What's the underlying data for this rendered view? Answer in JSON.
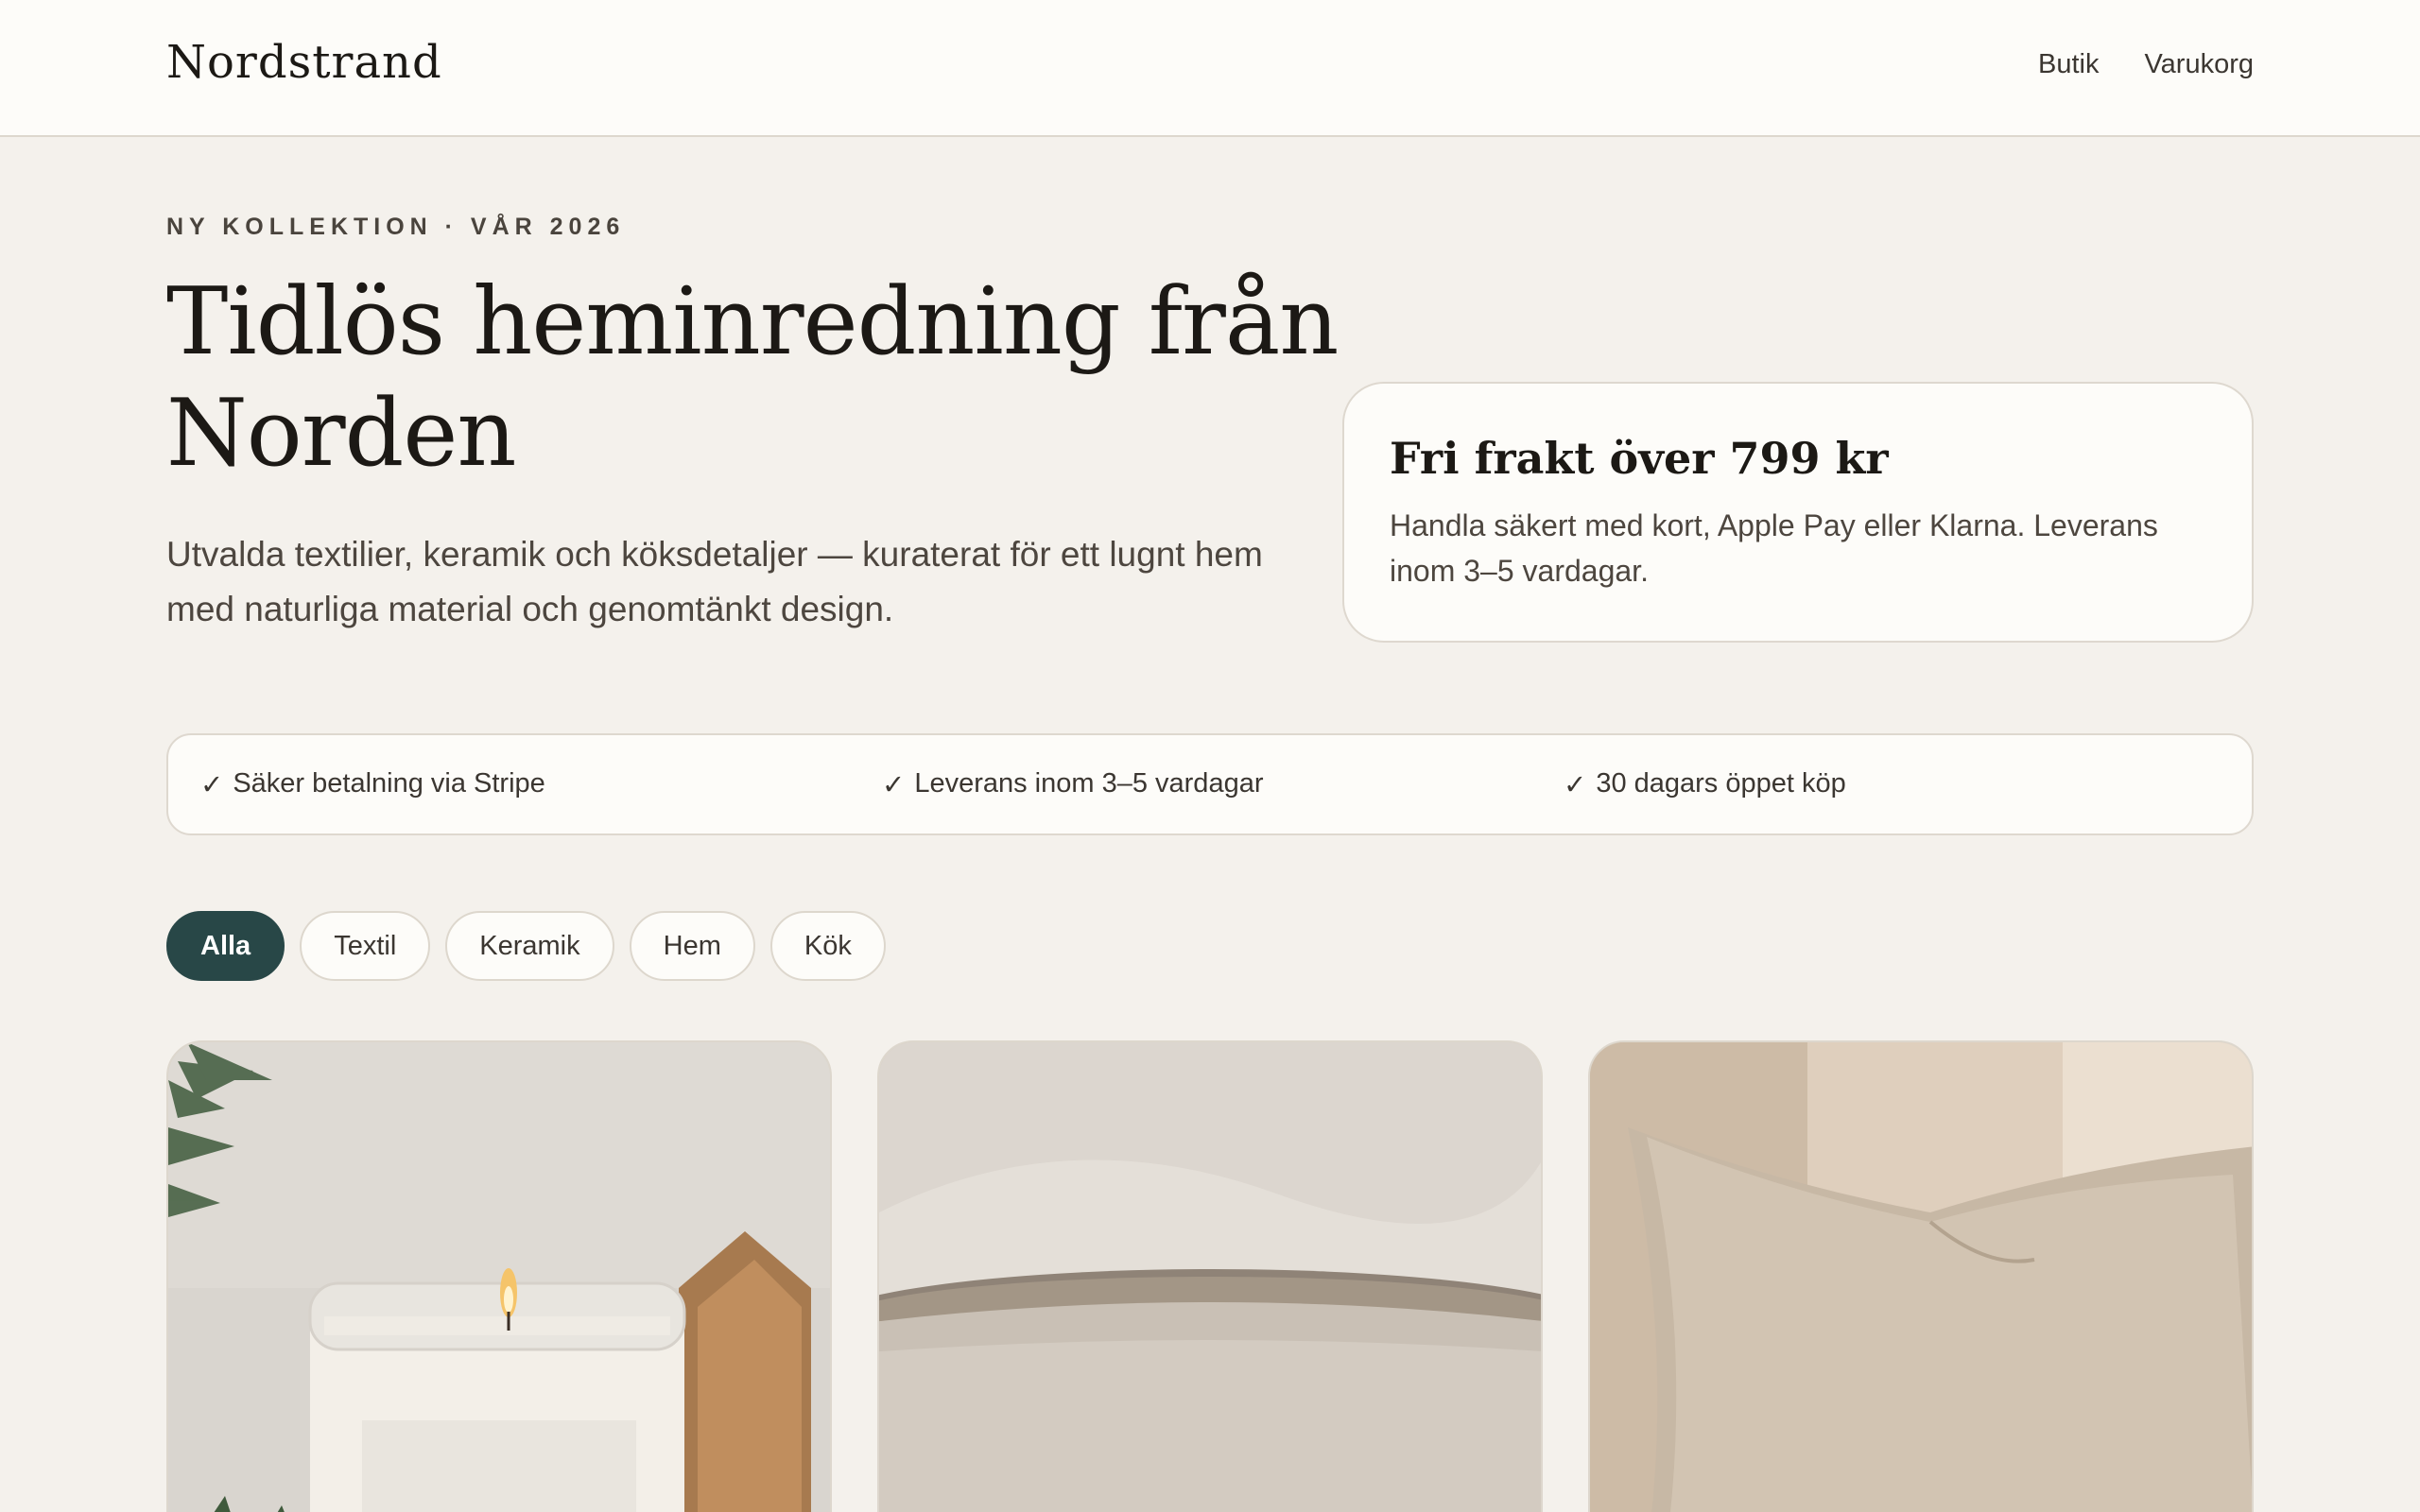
{
  "header": {
    "brand": "Nordstrand",
    "nav": [
      {
        "label": "Butik"
      },
      {
        "label": "Varukorg"
      }
    ]
  },
  "hero": {
    "eyebrow": "NY KOLLEKTION · VÅR 2026",
    "title": "Tidlös heminredning från Norden",
    "lede": "Utvalda textilier, keramik och köksdetaljer — kuraterat för ett lugnt hem med naturliga material och genomtänkt design."
  },
  "shipping_card": {
    "title": "Fri frakt över 799 kr",
    "text": "Handla säkert med kort, Apple Pay eller Klarna. Leverans inom 3–5 vardagar."
  },
  "benefits": [
    {
      "check": "✓",
      "text": "Säker betalning via Stripe"
    },
    {
      "check": "✓",
      "text": "Leverans inom 3–5 vardagar"
    },
    {
      "check": "✓",
      "text": "30 dagars öppet köp"
    }
  ],
  "filters": [
    {
      "label": "Alla",
      "active": true
    },
    {
      "label": "Textil",
      "active": false
    },
    {
      "label": "Keramik",
      "active": false
    },
    {
      "label": "Hem",
      "active": false
    },
    {
      "label": "Kök",
      "active": false
    }
  ],
  "products": [
    {
      "image": "candle-image"
    },
    {
      "image": "ceramic-bowl-image"
    },
    {
      "image": "linen-cushion-image"
    }
  ],
  "colors": {
    "background": "#f4f1ec",
    "surface": "#fdfcf9",
    "accent": "#284747",
    "text": "#1c1915"
  }
}
